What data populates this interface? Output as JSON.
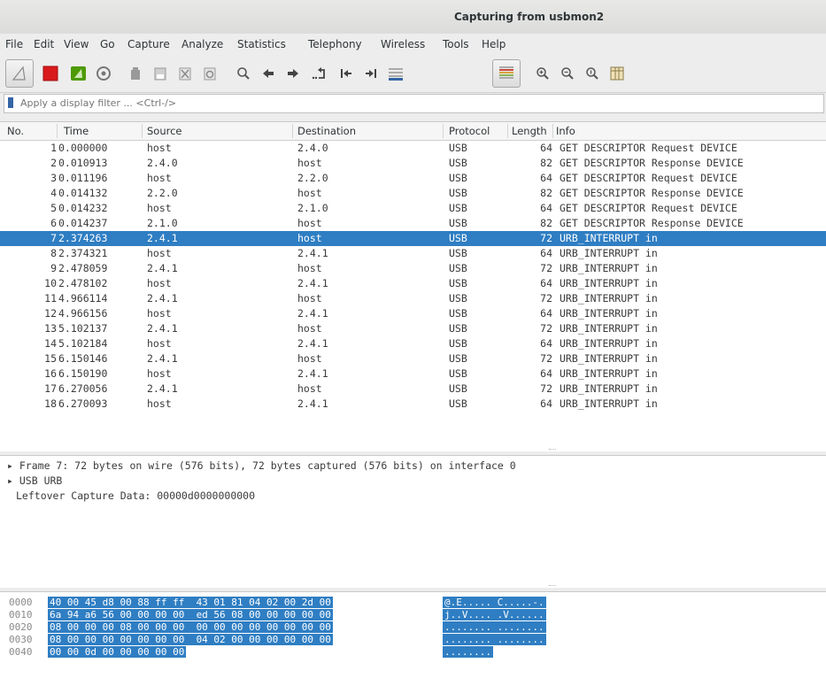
{
  "window": {
    "title": "Capturing from usbmon2"
  },
  "menu": [
    "File",
    "Edit",
    "View",
    "Go",
    "Capture",
    "Analyze",
    "Statistics",
    "Telephony",
    "Wireless",
    "Tools",
    "Help"
  ],
  "toolbar": {
    "icons": [
      "shark-fin-start-icon",
      "stop-capture-icon",
      "restart-capture-icon",
      "capture-options-icon",
      "open-file-icon",
      "save-file-icon",
      "close-file-icon",
      "reload-file-icon",
      "find-packet-icon",
      "go-back-icon",
      "go-forward-icon",
      "go-to-packet-icon",
      "go-first-icon",
      "go-last-icon",
      "auto-scroll-icon",
      "colorize-icon",
      "zoom-in-icon",
      "zoom-out-icon",
      "normal-size-icon",
      "resize-columns-icon"
    ]
  },
  "filter": {
    "placeholder": "Apply a display filter ... <Ctrl-/>"
  },
  "columns": {
    "no": "No.",
    "time": "Time",
    "source": "Source",
    "destination": "Destination",
    "protocol": "Protocol",
    "length": "Length",
    "info": "Info"
  },
  "packets": [
    {
      "no": "1",
      "time": "0.000000",
      "src": "host",
      "dst": "2.4.0",
      "proto": "USB",
      "len": "64",
      "info": "GET DESCRIPTOR Request DEVICE"
    },
    {
      "no": "2",
      "time": "0.010913",
      "src": "2.4.0",
      "dst": "host",
      "proto": "USB",
      "len": "82",
      "info": "GET DESCRIPTOR Response DEVICE"
    },
    {
      "no": "3",
      "time": "0.011196",
      "src": "host",
      "dst": "2.2.0",
      "proto": "USB",
      "len": "64",
      "info": "GET DESCRIPTOR Request DEVICE"
    },
    {
      "no": "4",
      "time": "0.014132",
      "src": "2.2.0",
      "dst": "host",
      "proto": "USB",
      "len": "82",
      "info": "GET DESCRIPTOR Response DEVICE"
    },
    {
      "no": "5",
      "time": "0.014232",
      "src": "host",
      "dst": "2.1.0",
      "proto": "USB",
      "len": "64",
      "info": "GET DESCRIPTOR Request DEVICE"
    },
    {
      "no": "6",
      "time": "0.014237",
      "src": "2.1.0",
      "dst": "host",
      "proto": "USB",
      "len": "82",
      "info": "GET DESCRIPTOR Response DEVICE"
    },
    {
      "no": "7",
      "time": "2.374263",
      "src": "2.4.1",
      "dst": "host",
      "proto": "USB",
      "len": "72",
      "info": "URB_INTERRUPT in"
    },
    {
      "no": "8",
      "time": "2.374321",
      "src": "host",
      "dst": "2.4.1",
      "proto": "USB",
      "len": "64",
      "info": "URB_INTERRUPT in"
    },
    {
      "no": "9",
      "time": "2.478059",
      "src": "2.4.1",
      "dst": "host",
      "proto": "USB",
      "len": "72",
      "info": "URB_INTERRUPT in"
    },
    {
      "no": "10",
      "time": "2.478102",
      "src": "host",
      "dst": "2.4.1",
      "proto": "USB",
      "len": "64",
      "info": "URB_INTERRUPT in"
    },
    {
      "no": "11",
      "time": "4.966114",
      "src": "2.4.1",
      "dst": "host",
      "proto": "USB",
      "len": "72",
      "info": "URB_INTERRUPT in"
    },
    {
      "no": "12",
      "time": "4.966156",
      "src": "host",
      "dst": "2.4.1",
      "proto": "USB",
      "len": "64",
      "info": "URB_INTERRUPT in"
    },
    {
      "no": "13",
      "time": "5.102137",
      "src": "2.4.1",
      "dst": "host",
      "proto": "USB",
      "len": "72",
      "info": "URB_INTERRUPT in"
    },
    {
      "no": "14",
      "time": "5.102184",
      "src": "host",
      "dst": "2.4.1",
      "proto": "USB",
      "len": "64",
      "info": "URB_INTERRUPT in"
    },
    {
      "no": "15",
      "time": "6.150146",
      "src": "2.4.1",
      "dst": "host",
      "proto": "USB",
      "len": "72",
      "info": "URB_INTERRUPT in"
    },
    {
      "no": "16",
      "time": "6.150190",
      "src": "host",
      "dst": "2.4.1",
      "proto": "USB",
      "len": "64",
      "info": "URB_INTERRUPT in"
    },
    {
      "no": "17",
      "time": "6.270056",
      "src": "2.4.1",
      "dst": "host",
      "proto": "USB",
      "len": "72",
      "info": "URB_INTERRUPT in"
    },
    {
      "no": "18",
      "time": "6.270093",
      "src": "host",
      "dst": "2.4.1",
      "proto": "USB",
      "len": "64",
      "info": "URB_INTERRUPT in"
    }
  ],
  "selected_packet": "7",
  "colors": {
    "selection": "#2f7ec3",
    "stop_red": "#d9191c",
    "restart_green": "#4e9a06"
  },
  "details": [
    {
      "expander": "▸",
      "text": "Frame 7: 72 bytes on wire (576 bits), 72 bytes captured (576 bits) on interface 0"
    },
    {
      "expander": "▸",
      "text": "USB URB"
    },
    {
      "expander": "",
      "text": "Leftover Capture Data: 00000d0000000000"
    }
  ],
  "hex": [
    {
      "offset": "0000",
      "hex": "40 00 45 d8 00 88 ff ff  43 01 81 04 02 00 2d 00",
      "ascii": "@.E..... C.....-."
    },
    {
      "offset": "0010",
      "hex": "6a 94 a6 56 00 00 00 00  ed 56 08 00 00 00 00 00",
      "ascii": "j..V.... .V......"
    },
    {
      "offset": "0020",
      "hex": "08 00 00 00 08 00 00 00  00 00 00 00 00 00 00 00",
      "ascii": "........ ........"
    },
    {
      "offset": "0030",
      "hex": "08 00 00 00 00 00 00 00  04 02 00 00 00 00 00 00",
      "ascii": "........ ........"
    },
    {
      "offset": "0040",
      "hex": "00 00 0d 00 00 00 00 00",
      "ascii": "........"
    }
  ]
}
